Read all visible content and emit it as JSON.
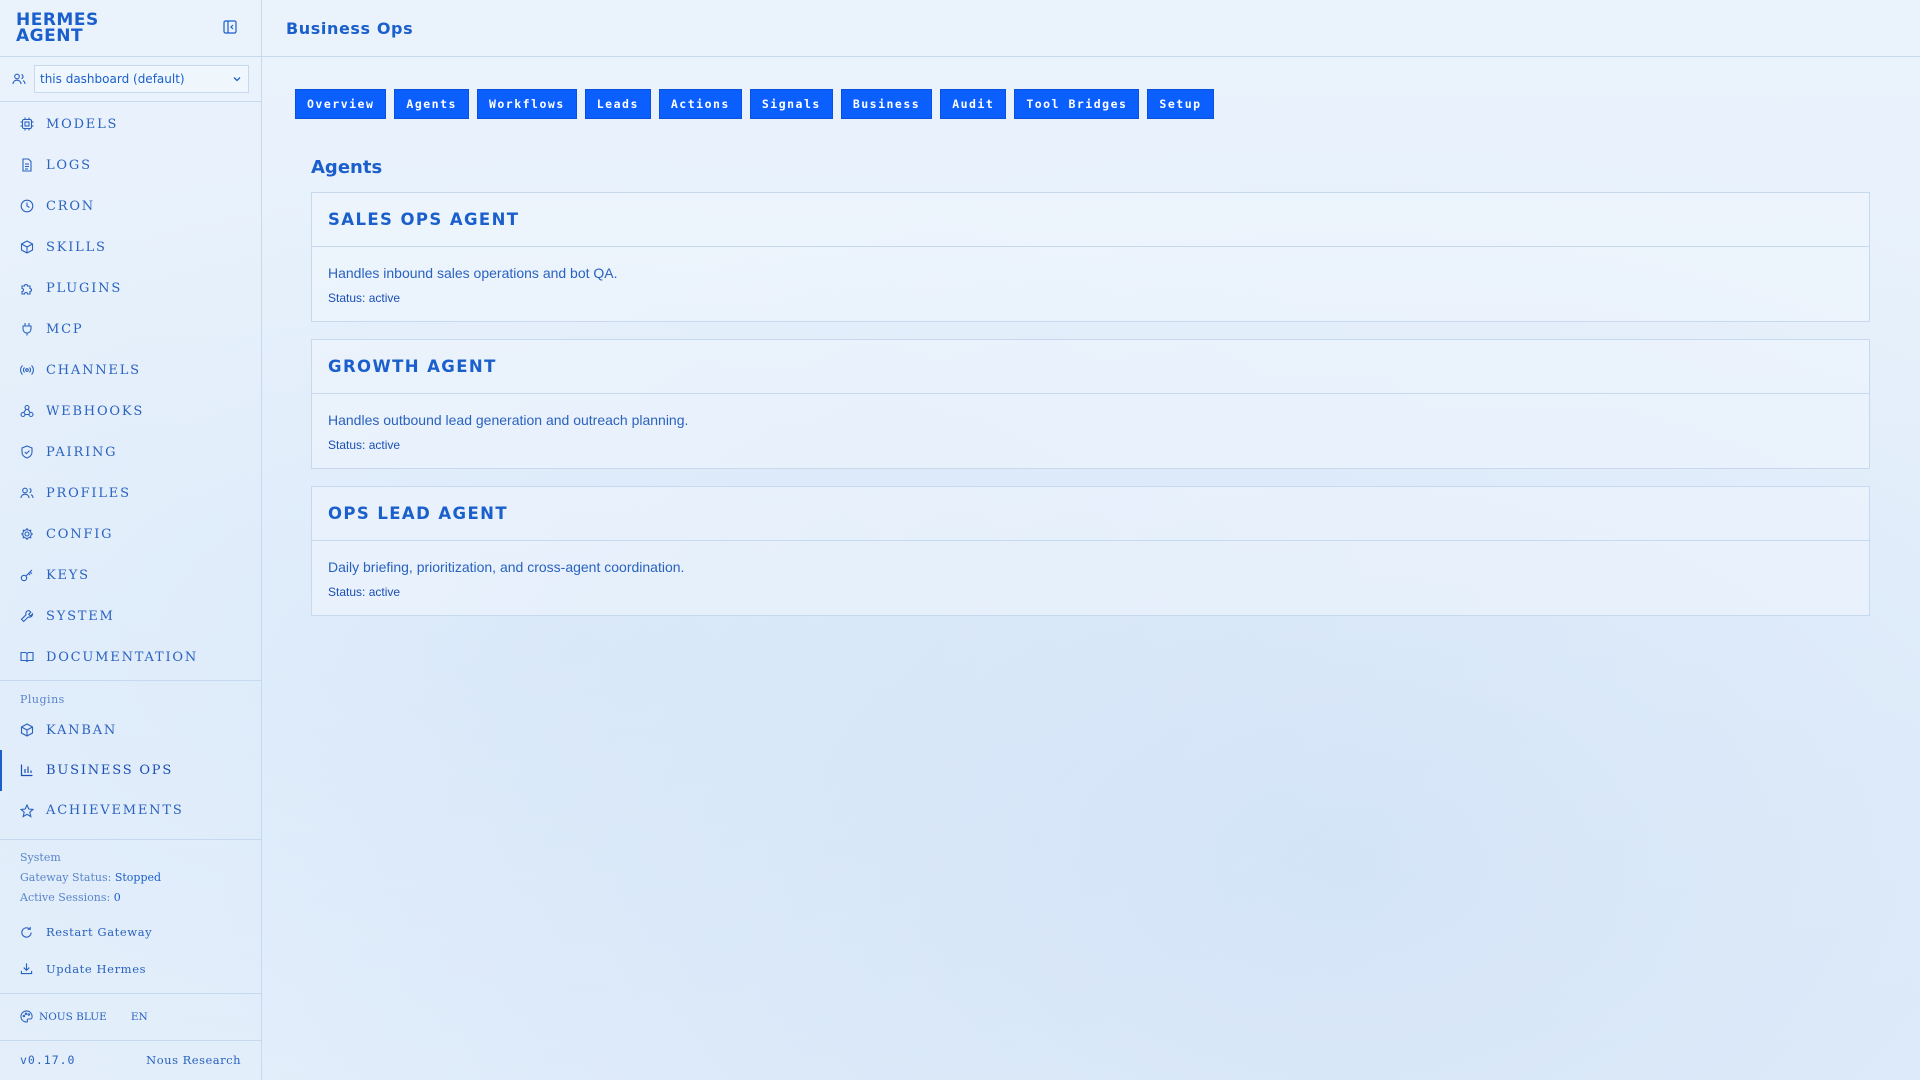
{
  "app": {
    "brand_line1": "HERMES",
    "brand_line2": "AGENT",
    "profile_select": "this dashboard (default)"
  },
  "sidebar": {
    "items": [
      {
        "label": "MODELS",
        "icon": "cube-icon"
      },
      {
        "label": "LOGS",
        "icon": "file-icon"
      },
      {
        "label": "CRON",
        "icon": "clock-icon"
      },
      {
        "label": "SKILLS",
        "icon": "package-icon"
      },
      {
        "label": "PLUGINS",
        "icon": "puzzle-icon"
      },
      {
        "label": "MCP",
        "icon": "plug-icon"
      },
      {
        "label": "CHANNELS",
        "icon": "radio-icon"
      },
      {
        "label": "WEBHOOKS",
        "icon": "webhook-icon"
      },
      {
        "label": "PAIRING",
        "icon": "shield-icon"
      },
      {
        "label": "PROFILES",
        "icon": "users-icon"
      },
      {
        "label": "CONFIG",
        "icon": "gear-icon"
      },
      {
        "label": "KEYS",
        "icon": "key-icon"
      },
      {
        "label": "SYSTEM",
        "icon": "wrench-icon"
      },
      {
        "label": "DOCUMENTATION",
        "icon": "book-icon"
      }
    ],
    "plugins_label": "Plugins",
    "plugin_items": [
      {
        "label": "KANBAN",
        "icon": "package-icon"
      },
      {
        "label": "BUSINESS OPS",
        "icon": "bar-chart-icon",
        "active": true
      },
      {
        "label": "ACHIEVEMENTS",
        "icon": "star-icon"
      }
    ],
    "system": {
      "label": "System",
      "gateway_status_label": "Gateway Status:",
      "gateway_status_value": "Stopped",
      "active_sessions_label": "Active Sessions:",
      "active_sessions_value": "0",
      "restart_label": "Restart Gateway",
      "update_label": "Update Hermes"
    },
    "theme": "NOUS BLUE",
    "language": "EN",
    "version": "v0.17.0",
    "org": "Nous Research"
  },
  "header": {
    "title": "Business Ops"
  },
  "tabs": [
    "Overview",
    "Agents",
    "Workflows",
    "Leads",
    "Actions",
    "Signals",
    "Business",
    "Audit",
    "Tool Bridges",
    "Setup"
  ],
  "main": {
    "section_title": "Agents",
    "agents": [
      {
        "name": "SALES OPS AGENT",
        "description": "Handles inbound sales operations and bot QA.",
        "status": "Status: active"
      },
      {
        "name": "GROWTH AGENT",
        "description": "Handles outbound lead generation and outreach planning.",
        "status": "Status: active"
      },
      {
        "name": "OPS LEAD AGENT",
        "description": "Daily briefing, prioritization, and cross-agent coordination.",
        "status": "Status: active"
      }
    ]
  },
  "colors": {
    "accent": "#1a5fcc",
    "tab_bg": "#0b5fff",
    "background": "#e6f0fb",
    "border": "#c7d9ef"
  }
}
